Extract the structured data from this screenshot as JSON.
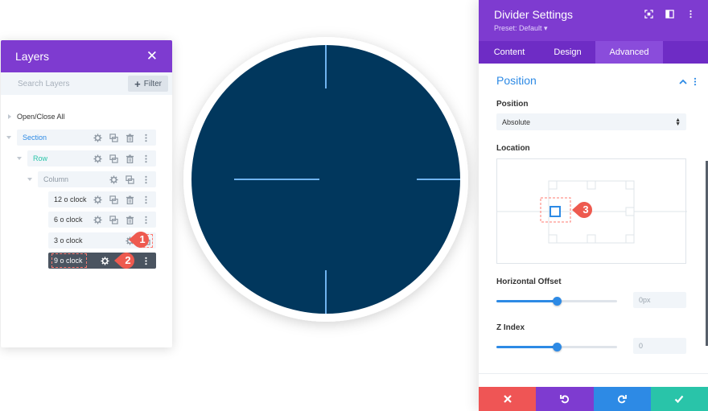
{
  "layers_panel": {
    "title": "Layers",
    "close_glyph": "✕",
    "search_placeholder": "Search Layers",
    "filter_label": "Filter",
    "open_close_all": "Open/Close All",
    "tree": {
      "section": "Section",
      "row": "Row",
      "column": "Column",
      "modules": [
        "12 o clock",
        "6 o clock",
        "3 o clock",
        "9 o clock"
      ]
    },
    "selected_module": "9 o clock",
    "colors": {
      "header": "#7e3bd0",
      "section": "#2d8ae5",
      "row": "#29c4a9",
      "column": "#8e98a3"
    }
  },
  "badges": [
    "1",
    "2",
    "3"
  ],
  "settings_panel": {
    "title": "Divider Settings",
    "preset": "Preset: Default ▾",
    "tabs": [
      {
        "label": "Content",
        "active": false
      },
      {
        "label": "Design",
        "active": false
      },
      {
        "label": "Advanced",
        "active": true
      }
    ],
    "section_title": "Position",
    "position_label": "Position",
    "position_value": "Absolute",
    "location_label": "Location",
    "location_selected": "left-center",
    "horizontal_offset_label": "Horizontal Offset",
    "horizontal_offset_placeholder": "0px",
    "horizontal_offset_slider": 0.5,
    "z_index_label": "Z Index",
    "z_index_placeholder": "0",
    "z_index_slider": 0.5,
    "footer_buttons": [
      {
        "name": "discard",
        "icon": "close-icon",
        "color": "#ef5555"
      },
      {
        "name": "undo",
        "icon": "undo-icon",
        "color": "#7e3bd0"
      },
      {
        "name": "redo",
        "icon": "redo-icon",
        "color": "#2d8ae5"
      },
      {
        "name": "save",
        "icon": "check-icon",
        "color": "#29c4a9"
      }
    ]
  },
  "clock": {
    "face_color": "#01375d",
    "ring_color": "#ffffff",
    "tick_color": "#6fb3ef"
  }
}
